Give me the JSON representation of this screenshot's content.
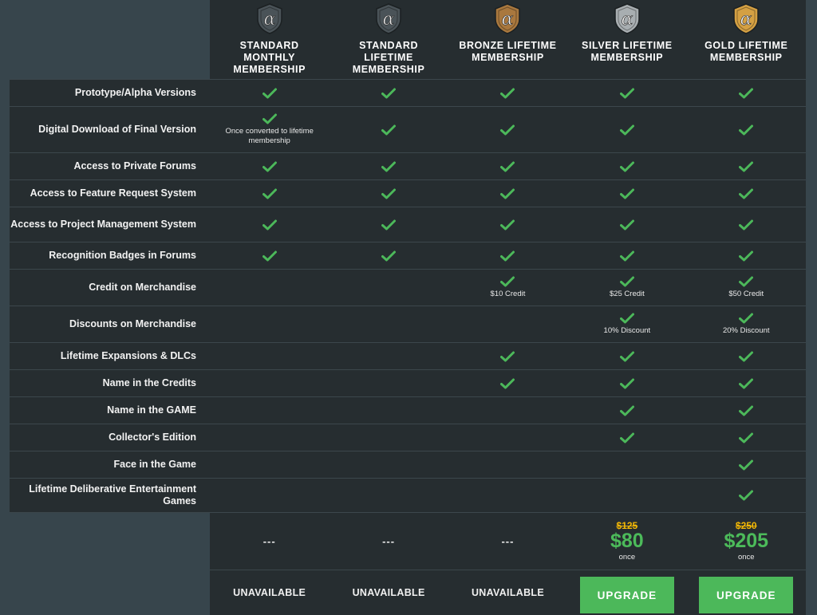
{
  "plans": [
    {
      "title": "STANDARD MONTHLY MEMBERSHIP",
      "badge": "alpha-dark-badge-icon",
      "tone": "dark"
    },
    {
      "title": "STANDARD LIFETIME MEMBERSHIP",
      "badge": "alpha-dark-badge-icon",
      "tone": "dark"
    },
    {
      "title": "BRONZE LIFETIME MEMBERSHIP",
      "badge": "alpha-bronze-badge-icon",
      "tone": "bronze"
    },
    {
      "title": "SILVER LIFETIME MEMBERSHIP",
      "badge": "alpha-silver-badge-icon",
      "tone": "silver"
    },
    {
      "title": "GOLD LIFETIME MEMBERSHIP",
      "badge": "alpha-gold-badge-icon",
      "tone": "gold"
    }
  ],
  "badge_colors": {
    "dark": "#4a5358",
    "bronze": "#a9783e",
    "silver": "#a8aeb1",
    "gold": "#d4a043"
  },
  "features": [
    {
      "label": "Prototype/Alpha Versions",
      "cells": [
        {
          "check": true
        },
        {
          "check": true
        },
        {
          "check": true
        },
        {
          "check": true
        },
        {
          "check": true
        }
      ]
    },
    {
      "label": "Digital Download of Final Version",
      "cells": [
        {
          "check": true,
          "note": "Once converted to lifetime membership"
        },
        {
          "check": true
        },
        {
          "check": true
        },
        {
          "check": true
        },
        {
          "check": true
        }
      ]
    },
    {
      "label": "Access to Private Forums",
      "cells": [
        {
          "check": true
        },
        {
          "check": true
        },
        {
          "check": true
        },
        {
          "check": true
        },
        {
          "check": true
        }
      ]
    },
    {
      "label": "Access to Feature Request System",
      "cells": [
        {
          "check": true
        },
        {
          "check": true
        },
        {
          "check": true
        },
        {
          "check": true
        },
        {
          "check": true
        }
      ]
    },
    {
      "label": "Access to Project Management System",
      "cells": [
        {
          "check": true
        },
        {
          "check": true
        },
        {
          "check": true
        },
        {
          "check": true
        },
        {
          "check": true
        }
      ]
    },
    {
      "label": "Recognition Badges in Forums",
      "cells": [
        {
          "check": true
        },
        {
          "check": true
        },
        {
          "check": true
        },
        {
          "check": true
        },
        {
          "check": true
        }
      ]
    },
    {
      "label": "Credit on Merchandise",
      "cells": [
        {},
        {},
        {
          "check": true,
          "note": "$10 Credit"
        },
        {
          "check": true,
          "note": "$25 Credit"
        },
        {
          "check": true,
          "note": "$50 Credit"
        }
      ]
    },
    {
      "label": "Discounts on Merchandise",
      "cells": [
        {},
        {},
        {},
        {
          "check": true,
          "note": "10% Discount"
        },
        {
          "check": true,
          "note": "20% Discount"
        }
      ]
    },
    {
      "label": "Lifetime Expansions & DLCs",
      "cells": [
        {},
        {},
        {
          "check": true
        },
        {
          "check": true
        },
        {
          "check": true
        }
      ]
    },
    {
      "label": "Name in the Credits",
      "cells": [
        {},
        {},
        {
          "check": true
        },
        {
          "check": true
        },
        {
          "check": true
        }
      ]
    },
    {
      "label": "Name in the GAME",
      "cells": [
        {},
        {},
        {},
        {
          "check": true
        },
        {
          "check": true
        }
      ]
    },
    {
      "label": "Collector's Edition",
      "cells": [
        {},
        {},
        {},
        {
          "check": true
        },
        {
          "check": true
        }
      ]
    },
    {
      "label": "Face in the Game",
      "cells": [
        {},
        {},
        {},
        {},
        {
          "check": true
        }
      ]
    },
    {
      "label": "Lifetime Deliberative Entertainment Games",
      "cells": [
        {},
        {},
        {},
        {},
        {
          "check": true
        }
      ]
    }
  ],
  "pricing": [
    {
      "dash": "---"
    },
    {
      "dash": "---"
    },
    {
      "dash": "---"
    },
    {
      "old": "$125",
      "new": "$80",
      "period": "once"
    },
    {
      "old": "$250",
      "new": "$205",
      "period": "once"
    }
  ],
  "actions": [
    {
      "type": "unavailable",
      "label": "UNAVAILABLE"
    },
    {
      "type": "unavailable",
      "label": "UNAVAILABLE"
    },
    {
      "type": "unavailable",
      "label": "UNAVAILABLE"
    },
    {
      "type": "button",
      "label": "UPGRADE"
    },
    {
      "type": "button",
      "label": "UPGRADE"
    }
  ],
  "colors": {
    "check": "#4cb85a",
    "strike_price": "#f2b705",
    "price": "#4cbb5a",
    "upgrade_bg": "#4cb85a",
    "page_bg": "#37454c",
    "panel_bg": "#262d30"
  }
}
